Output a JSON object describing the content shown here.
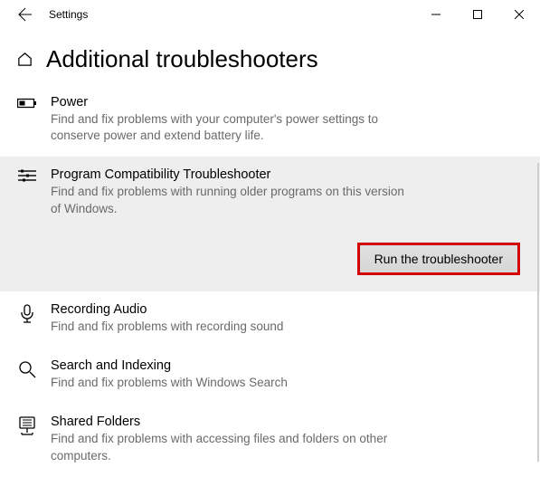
{
  "window": {
    "title": "Settings"
  },
  "page": {
    "title": "Additional troubleshooters"
  },
  "items": [
    {
      "title": "Power",
      "desc": "Find and fix problems with your computer's power settings to conserve power and extend battery life."
    },
    {
      "title": "Program Compatibility Troubleshooter",
      "desc": "Find and fix problems with running older programs on this version of Windows.",
      "button": "Run the troubleshooter"
    },
    {
      "title": "Recording Audio",
      "desc": "Find and fix problems with recording sound"
    },
    {
      "title": "Search and Indexing",
      "desc": "Find and fix problems with Windows Search"
    },
    {
      "title": "Shared Folders",
      "desc": "Find and fix problems with accessing files and folders on other computers."
    }
  ]
}
